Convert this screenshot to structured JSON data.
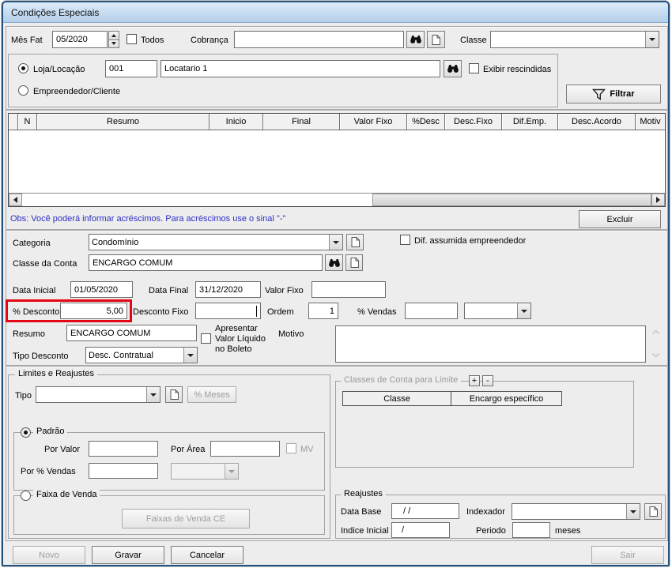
{
  "window": {
    "title": "Condições Especiais"
  },
  "colors": {
    "title_bar": "#b4cfe9",
    "window_border": "#24527f",
    "highlight_red": "#e30613",
    "obs_blue": "#2f2fc4"
  },
  "top_bar": {
    "mes_fat_label": "Mês Fat",
    "mes_fat_value": "05/2020",
    "todos_label": "Todos",
    "cobranca_label": "Cobrança",
    "cobranca_value": "",
    "classe_label": "Classe",
    "classe_value": ""
  },
  "entity": {
    "loja_label": "Loja/Locação",
    "loja_code": "001",
    "loja_name": "Locatario 1",
    "empreendedor_label": "Empreendedor/Cliente",
    "exibir_label": "Exibir rescindidas",
    "filtrar_label": "Filtrar"
  },
  "grid": {
    "columns": [
      "",
      "N",
      "Resumo",
      "Inicio",
      "Final",
      "Valor Fixo",
      "%Desc",
      "Desc.Fixo",
      "Dif.Emp.",
      "Desc.Acordo",
      "Motiv"
    ],
    "rows": []
  },
  "obs_text": "Obs: Você poderá informar acréscimos. Para acréscimos use o sinal \"-\"",
  "actions": {
    "excluir": "Excluir",
    "novo": "Novo",
    "gravar": "Gravar",
    "cancelar": "Cancelar",
    "sair": "Sair"
  },
  "detail": {
    "categoria_label": "Categoria",
    "categoria_value": "Condomínio",
    "dif_assumida_label": "Dif. assumida empreendedor",
    "classe_conta_label": "Classe da Conta",
    "classe_conta_value": "ENCARGO COMUM",
    "data_inicial_label": "Data Inicial",
    "data_inicial_value": "01/05/2020",
    "data_final_label": "Data Final",
    "data_final_value": "31/12/2020",
    "valor_fixo_label": "Valor Fixo",
    "valor_fixo_value": "",
    "desconto_label": "% Desconto",
    "desconto_value": "5,00",
    "desconto_fixo_label": "Desconto Fixo",
    "desconto_fixo_value": "",
    "ordem_label": "Ordem",
    "ordem_value": "1",
    "vendas_label": "% Vendas",
    "vendas_value": "",
    "resumo_label": "Resumo",
    "resumo_value": "ENCARGO COMUM",
    "apresentar_line1": "Apresentar",
    "apresentar_line2": "Valor Líquido",
    "apresentar_line3": "no Boleto",
    "motivo_label": "Motivo",
    "motivo_value": "",
    "tipo_desconto_label": "Tipo Desconto",
    "tipo_desconto_value": "Desc. Contratual"
  },
  "limites": {
    "title": "Limites e Reajustes",
    "tipo_label": "Tipo",
    "tipo_value": "",
    "meses_button": "% Meses",
    "padrao": {
      "label": "Padrão",
      "por_valor_label": "Por Valor",
      "por_area_label": "Por Área",
      "mv_label": "MV",
      "por_vendas_label": "Por % Vendas"
    },
    "faixa": {
      "label": "Faixa de Venda",
      "button": "Faixas de Venda CE"
    }
  },
  "classes_limite": {
    "title": "Classes de Conta para Limite",
    "plus": "+",
    "minus": "-",
    "col_classe": "Classe",
    "col_encargo": "Encargo específico"
  },
  "reajustes": {
    "title": "Reajustes",
    "data_base_label": "Data Base",
    "data_base_value": "/ /",
    "indexador_label": "Indexador",
    "indexador_value": "",
    "indice_label": "Indice Inicial",
    "indice_value": "/",
    "periodo_label": "Periodo",
    "periodo_value": "",
    "meses_label": "meses"
  }
}
